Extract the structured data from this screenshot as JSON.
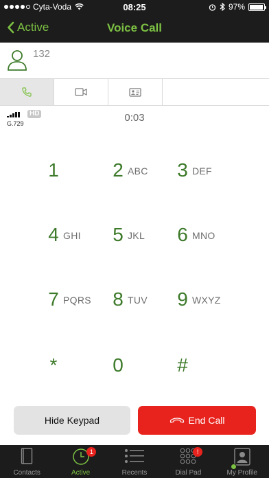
{
  "status_bar": {
    "carrier": "Cyta-Voda",
    "time": "08:25",
    "battery_text": "97%",
    "battery_level": 0.97
  },
  "nav": {
    "back_label": "Active",
    "title": "Voice Call"
  },
  "contact": {
    "number": "132"
  },
  "call": {
    "hd_label": "HD",
    "codec": "G.729",
    "duration": "0:03"
  },
  "keypad": {
    "keys": [
      {
        "digit": "1",
        "letters": ""
      },
      {
        "digit": "2",
        "letters": "ABC"
      },
      {
        "digit": "3",
        "letters": "DEF"
      },
      {
        "digit": "4",
        "letters": "GHI"
      },
      {
        "digit": "5",
        "letters": "JKL"
      },
      {
        "digit": "6",
        "letters": "MNO"
      },
      {
        "digit": "7",
        "letters": "PQRS"
      },
      {
        "digit": "8",
        "letters": "TUV"
      },
      {
        "digit": "9",
        "letters": "WXYZ"
      },
      {
        "digit": "*",
        "letters": ""
      },
      {
        "digit": "0",
        "letters": ""
      },
      {
        "digit": "#",
        "letters": ""
      }
    ]
  },
  "actions": {
    "hide_keypad": "Hide Keypad",
    "end_call": "End Call"
  },
  "tabbar": {
    "items": [
      {
        "label": "Contacts",
        "icon": "contacts-icon"
      },
      {
        "label": "Active",
        "icon": "clock-icon",
        "badge": "1"
      },
      {
        "label": "Recents",
        "icon": "list-icon"
      },
      {
        "label": "Dial Pad",
        "icon": "dialpad-icon",
        "badge": "!"
      },
      {
        "label": "My Profile",
        "icon": "profile-icon"
      }
    ]
  },
  "colors": {
    "accent_green": "#7cc143",
    "digit_green": "#3d7a2a",
    "end_call_red": "#e8231d",
    "dark_bar": "#1c1c1c"
  }
}
